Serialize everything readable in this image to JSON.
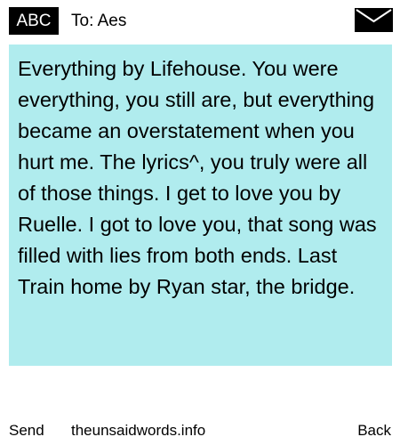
{
  "header": {
    "badge": "ABC",
    "to": "To: Aes",
    "icon": "envelope-icon"
  },
  "message": {
    "text": "Everything by Lifehouse. You were everything, you still are, but everything became an overstatement when you hurt me. The lyrics^, you truly were all of those things. I get to love you by Ruelle. I got to love you, that song was filled with lies from both ends. Last Train home by Ryan star, the bridge.",
    "background": "#b0ecee"
  },
  "footer": {
    "send_label": "Send",
    "site_label": "theunsaidwords.info",
    "back_label": "Back"
  }
}
